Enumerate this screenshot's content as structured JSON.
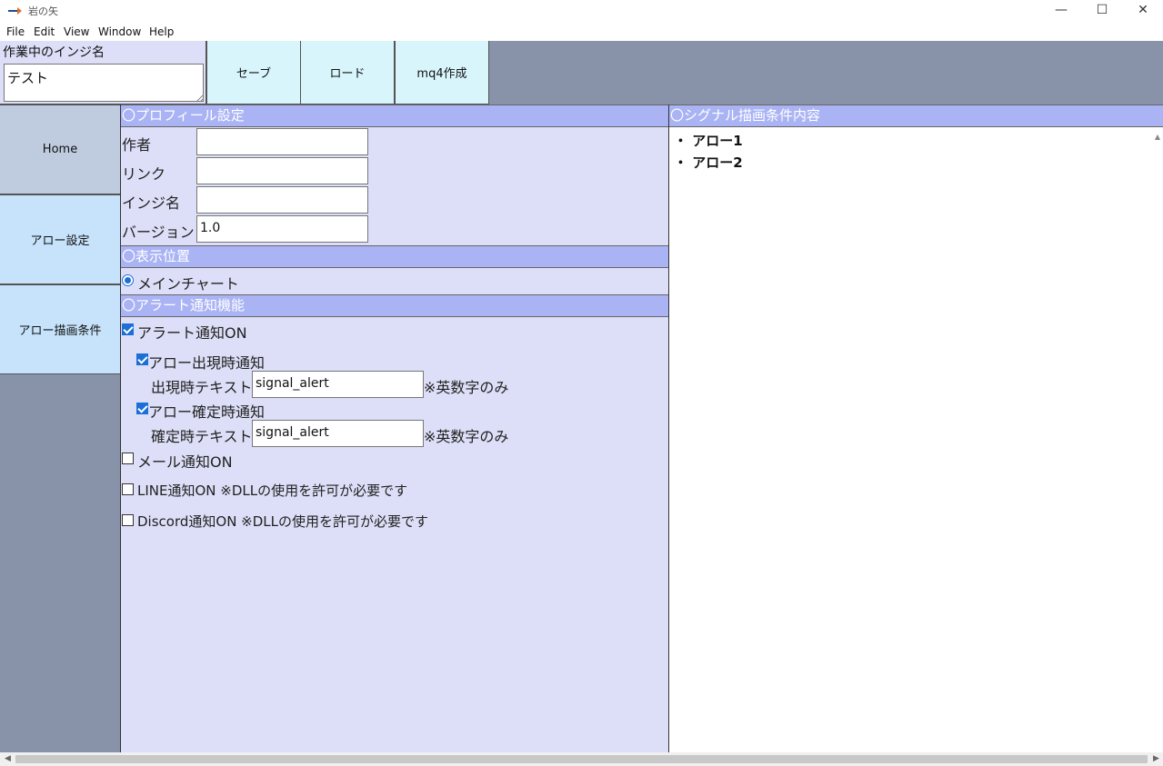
{
  "window": {
    "title": "岩の矢",
    "minimize": "—",
    "maximize": "☐",
    "close": "✕"
  },
  "menu": [
    "File",
    "Edit",
    "View",
    "Window",
    "Help"
  ],
  "toolbar": {
    "inji_label": "作業中のインジ名",
    "inji_value": "テスト",
    "save_label": "セーブ",
    "load_label": "ロード",
    "mq4_label": "mq4作成"
  },
  "sidebar": {
    "items": [
      {
        "label": "Home"
      },
      {
        "label": "アロー設定"
      },
      {
        "label": "アロー描画条件"
      }
    ]
  },
  "profile": {
    "heading": "〇プロフィール設定",
    "author_label": "作者",
    "author_value": "",
    "link_label": "リンク",
    "link_value": "",
    "inji_label": "インジ名",
    "inji_value": "",
    "version_label": "バージョン",
    "version_value": "1.0"
  },
  "display": {
    "heading": "〇表示位置",
    "main_chart_label": "メインチャート"
  },
  "alert": {
    "heading": "〇アラート通知機能",
    "alert_on_label": "アラート通知ON",
    "appear_label": "アロー出現時通知",
    "appear_text_label": "出現時テキスト",
    "appear_text_value": "signal_alert",
    "appear_note": "※英数字のみ",
    "confirm_label": "アロー確定時通知",
    "confirm_text_label": "確定時テキスト",
    "confirm_text_value": "signal_alert",
    "confirm_note": "※英数字のみ",
    "mail_label": "メール通知ON",
    "line_label": "LINE通知ON ※DLLの使用を許可が必要です",
    "discord_label": "Discord通知ON ※DLLの使用を許可が必要です"
  },
  "signal": {
    "heading": "〇シグナル描画条件内容",
    "items": [
      "・ アロー1",
      "・ アロー2"
    ]
  },
  "colors": {
    "panel_bg": "#dcdff7",
    "section_head": "#aab4f4",
    "sidebar_bg": "#8892a8",
    "button_bg": "#d8f5fc",
    "check_blue": "#1b6fd6"
  }
}
